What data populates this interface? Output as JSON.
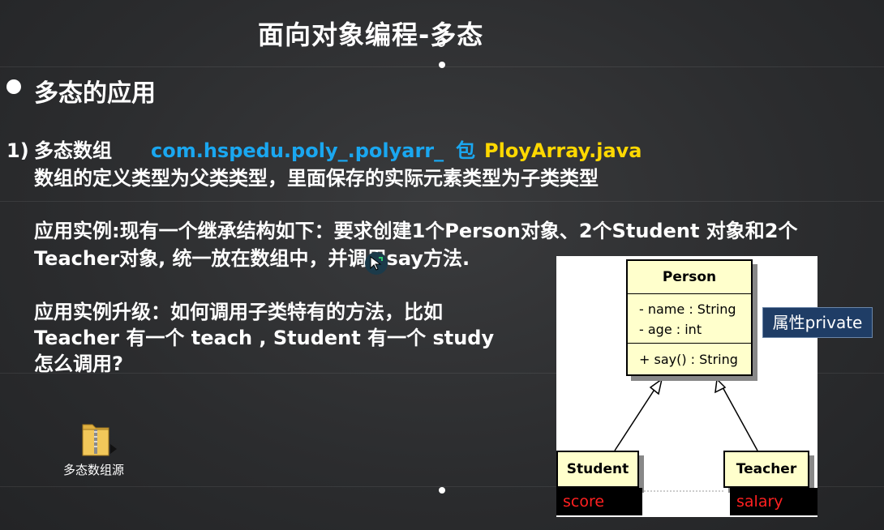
{
  "slide": {
    "title": "面向对象编程-多态",
    "heading": "多态的应用",
    "item_number": "1)",
    "item_title": "多态数组",
    "package_path": "com.hspedu.poly_.polyarr_",
    "package_word": "包",
    "file_name": "PloyArray.java",
    "line_definition": "数组的定义类型为父类类型，里面保存的实际元素类型为子类类型",
    "example_line1": "应用实例:现有一个继承结构如下：要求创建1个Person对象、2个Student 对象和2个",
    "example_line2": "Teacher对象, 统一放在数组中，并调用say方法.",
    "upgrade_line1": "应用实例升级：如何调用子类特有的方法，比如",
    "upgrade_line2": "Teacher 有一个 teach , Student 有一个 study",
    "upgrade_line3": "怎么调用?",
    "folder_label": "多态数组源"
  },
  "uml": {
    "parent_class": "Person",
    "attributes": [
      "- name : String",
      "- age : int"
    ],
    "methods": [
      "+ say() : String"
    ],
    "child_left": "Student",
    "child_left_field": "score",
    "child_right": "Teacher",
    "child_right_field": "salary",
    "private_tag": "属性private"
  },
  "colors": {
    "background": "#2a2b2d",
    "package": "#1aa7f0",
    "file": "#ffd800",
    "uml_class_fill": "#ffffcc",
    "field_text": "#ff2020",
    "tag_bg": "#1f3d66"
  }
}
